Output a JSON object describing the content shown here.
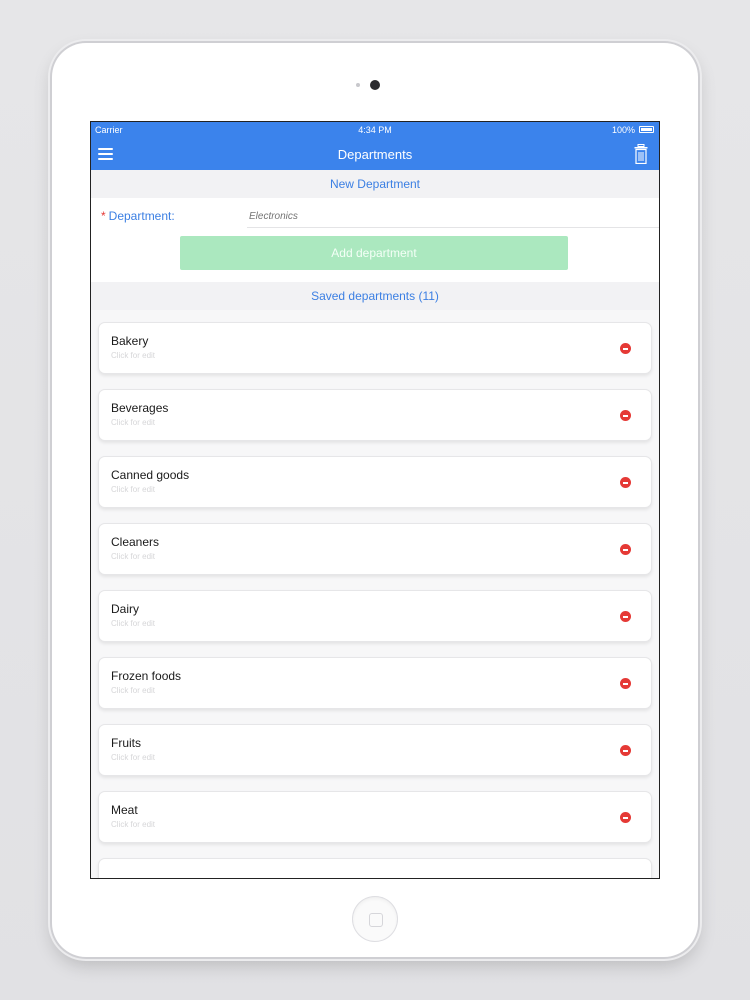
{
  "status_bar": {
    "carrier": "Carrier",
    "time": "4:34 PM",
    "battery": "100%"
  },
  "nav": {
    "title": "Departments",
    "left_icon": "menu-icon",
    "right_icon": "trash-icon"
  },
  "new_section": {
    "header": "New Department",
    "field_required_mark": "*",
    "field_label": "Department:",
    "field_placeholder": "Electronics",
    "add_button": "Add department"
  },
  "saved_section": {
    "header": "Saved departments (11)"
  },
  "departments": [
    {
      "name": "Bakery",
      "hint": "Click for edit"
    },
    {
      "name": "Beverages",
      "hint": "Click for edit"
    },
    {
      "name": "Canned goods",
      "hint": "Click for edit"
    },
    {
      "name": "Cleaners",
      "hint": "Click for edit"
    },
    {
      "name": "Dairy",
      "hint": "Click for edit"
    },
    {
      "name": "Frozen foods",
      "hint": "Click for edit"
    },
    {
      "name": "Fruits",
      "hint": "Click for edit"
    },
    {
      "name": "Meat",
      "hint": "Click for edit"
    }
  ],
  "colors": {
    "accent": "#3b83ec",
    "add_button": "#abe8bf",
    "remove": "#e53935"
  }
}
